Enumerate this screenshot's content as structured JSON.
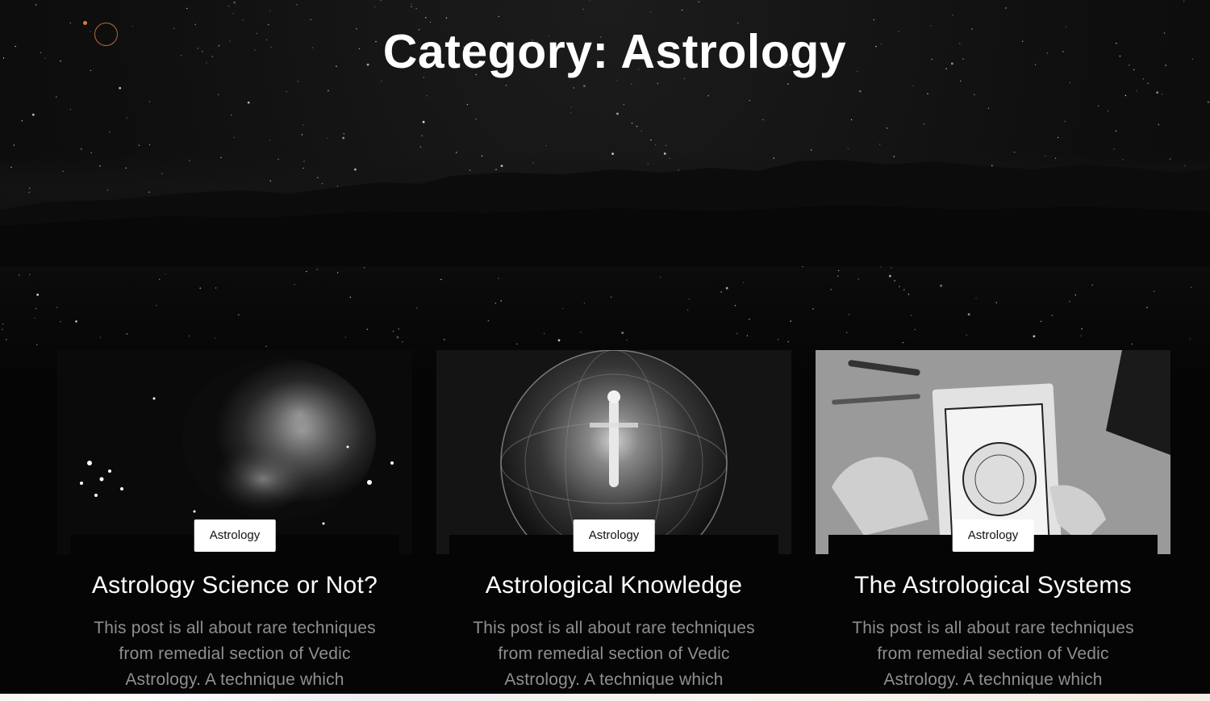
{
  "header": {
    "title": "Category: Astrology"
  },
  "loader": {
    "icon": "orbit-loader-icon",
    "accent": "#e0783f"
  },
  "posts": [
    {
      "category": "Astrology",
      "title": "Astrology Science or Not?",
      "excerpt": "This post is all about rare techniques from remedial section of Vedic Astrology. A technique which",
      "image": "orion-nebula-image"
    },
    {
      "category": "Astrology",
      "title": "Astrological Knowledge",
      "excerpt": "This post is all about rare techniques from remedial section of Vedic Astrology. A technique which",
      "image": "crystal-sphere-figure-image"
    },
    {
      "category": "Astrology",
      "title": "The Astrological Systems",
      "excerpt": "This post is all about rare techniques from remedial section of Vedic Astrology. A technique which",
      "image": "moon-book-hands-image"
    }
  ],
  "colors": {
    "background": "#070707",
    "title": "#ffffff",
    "excerpt": "#8f8f8f",
    "badge_bg": "#ffffff"
  }
}
